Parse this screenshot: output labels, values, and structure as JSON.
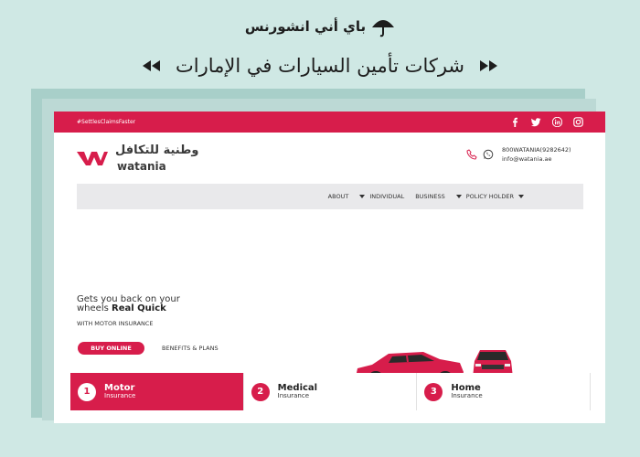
{
  "banner": {
    "brand_name": "باي أني انشورنس",
    "headline": "شركات تأمين السيارات في الإمارات"
  },
  "site": {
    "topbar": {
      "hashtag": "#SettlesClaimsFaster",
      "social_icons": [
        "facebook-icon",
        "twitter-icon",
        "linkedin-icon",
        "instagram-icon"
      ]
    },
    "logo": {
      "arabic": "وطنية للتكافل",
      "latin": "watania"
    },
    "contact": {
      "phone": "800WATANIA(9282642)",
      "email": "info@watania.ae"
    },
    "nav": {
      "items": [
        {
          "label": "ABOUT",
          "dropdown": false
        },
        {
          "label": "INDIVIDUAL",
          "dropdown": true
        },
        {
          "label": "BUSINESS",
          "dropdown": false
        },
        {
          "label": "POLICY HOLDER",
          "dropdown": true
        }
      ]
    },
    "hero": {
      "line1": "Gets you back on your",
      "line2_prefix": "wheels ",
      "line2_bold": "Real Quick",
      "subline": "WITH MOTOR INSURANCE",
      "buy_label": "BUY ONLINE",
      "benefits_label": "BENEFITS & PLANS"
    },
    "tabs": [
      {
        "number": "1",
        "title": "Motor",
        "subtitle": "Insurance",
        "active": true
      },
      {
        "number": "2",
        "title": "Medical",
        "subtitle": "Insurance",
        "active": false
      },
      {
        "number": "3",
        "title": "Home",
        "subtitle": "Insurance",
        "active": false
      }
    ]
  },
  "colors": {
    "brand_red": "#d71d4b",
    "background": "#cfe8e4",
    "nav_gray": "#e9e9eb"
  }
}
